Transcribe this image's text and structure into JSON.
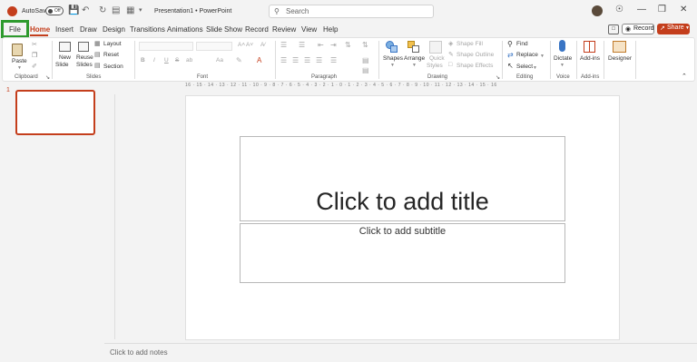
{
  "titlebar": {
    "autosave_label": "AutoSave",
    "autosave_state": "Off",
    "doc_title": "Presentation1 • PowerPoint",
    "search_placeholder": "Search",
    "minimize": "—",
    "restore": "❒",
    "close": "✕",
    "bulb": "☉"
  },
  "tabs": [
    "File",
    "Home",
    "Insert",
    "Draw",
    "Design",
    "Transitions",
    "Animations",
    "Slide Show",
    "Record",
    "Review",
    "View",
    "Help"
  ],
  "record_button": "Record",
  "share_button": "Share",
  "ribbon": {
    "clipboard": {
      "paste": "Paste",
      "group": "Clipboard"
    },
    "slides": {
      "new_slide_1": "New",
      "new_slide_2": "Slide",
      "reuse_1": "Reuse",
      "reuse_2": "Slides",
      "layout": "Layout",
      "reset": "Reset",
      "section": "Section",
      "group": "Slides"
    },
    "font": {
      "bold": "B",
      "italic": "I",
      "underline": "U",
      "strike": "S",
      "spacing": "ab",
      "aa": "Aa",
      "grow": "A˄",
      "shrink": "A˅",
      "group": "Font"
    },
    "paragraph": {
      "group": "Paragraph"
    },
    "drawing": {
      "shapes": "Shapes",
      "arrange": "Arrange",
      "quick_1": "Quick",
      "quick_2": "Styles",
      "fill": "Shape Fill",
      "outline": "Shape Outline",
      "effects": "Shape Effects",
      "group": "Drawing"
    },
    "editing": {
      "find": "Find",
      "replace": "Replace",
      "select": "Select",
      "group": "Editing"
    },
    "voice": {
      "dictate": "Dictate",
      "group": "Voice"
    },
    "addins": {
      "addins": "Add-ins",
      "group": "Add-ins"
    },
    "designer": {
      "designer": "Designer"
    }
  },
  "ruler_text": "16 · 15 · 14 · 13 · 12 · 11 · 10 · 9 · 8 · 7 · 6 · 5 · 4 · 3 · 2 · 1 · 0 · 1 · 2 · 3 · 4 · 5 · 6 · 7 · 8 · 9 · 10 · 11 · 12 · 13 · 14 · 15 · 16",
  "slide_panel": {
    "slide_number": "1"
  },
  "slide": {
    "title_placeholder": "Click to add title",
    "subtitle_placeholder": "Click to add subtitle"
  },
  "notes": {
    "placeholder": "Click to add notes"
  },
  "colors": {
    "accent": "#c43e1c",
    "highlight_box": "#2e9a2e"
  }
}
